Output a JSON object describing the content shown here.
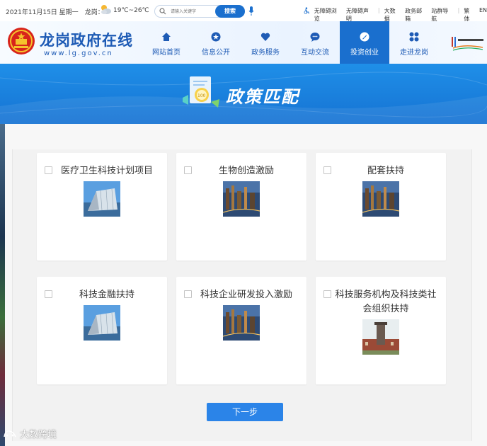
{
  "topbar": {
    "date": "2021年11月15日 星期一",
    "location": "龙岗：",
    "temperature": "19℃~26℃",
    "search_placeholder": "请输入关键字",
    "search_button": "搜索",
    "links": [
      "无障碍浏览",
      "无障碍声明",
      "大数据",
      "政务邮箱",
      "站群导航",
      "繁体",
      "EN"
    ]
  },
  "header": {
    "title": "龙岗政府在线",
    "url": "www.lg.gov.cn",
    "nav": [
      {
        "label": "网站首页",
        "icon": "home-icon"
      },
      {
        "label": "信息公开",
        "icon": "star-icon"
      },
      {
        "label": "政务服务",
        "icon": "heart-icon"
      },
      {
        "label": "互动交流",
        "icon": "chat-icon"
      },
      {
        "label": "投资创业",
        "icon": "rocket-icon",
        "active": true
      },
      {
        "label": "走进龙岗",
        "icon": "grid-icon"
      }
    ]
  },
  "banner": {
    "title": "政策匹配"
  },
  "cards": [
    {
      "title": "医疗卫生科技计划项目",
      "image": "building-photo"
    },
    {
      "title": "生物创造激励",
      "image": "city-night-photo"
    },
    {
      "title": "配套扶持",
      "image": "city-night-photo"
    },
    {
      "title": "科技金融扶持",
      "image": "building-photo"
    },
    {
      "title": "科技企业研发投入激励",
      "image": "city-night-photo"
    },
    {
      "title": "科技服务机构及科技类社会组织扶持",
      "image": "brick-tower-photo"
    }
  ],
  "next_button": "下一步",
  "watermark": "大数跨境",
  "colors": {
    "brand_blue": "#1a6fce",
    "banner_blue": "#1f8fe8",
    "button_blue": "#2b84e8",
    "nav_text": "#1e5bb5"
  }
}
